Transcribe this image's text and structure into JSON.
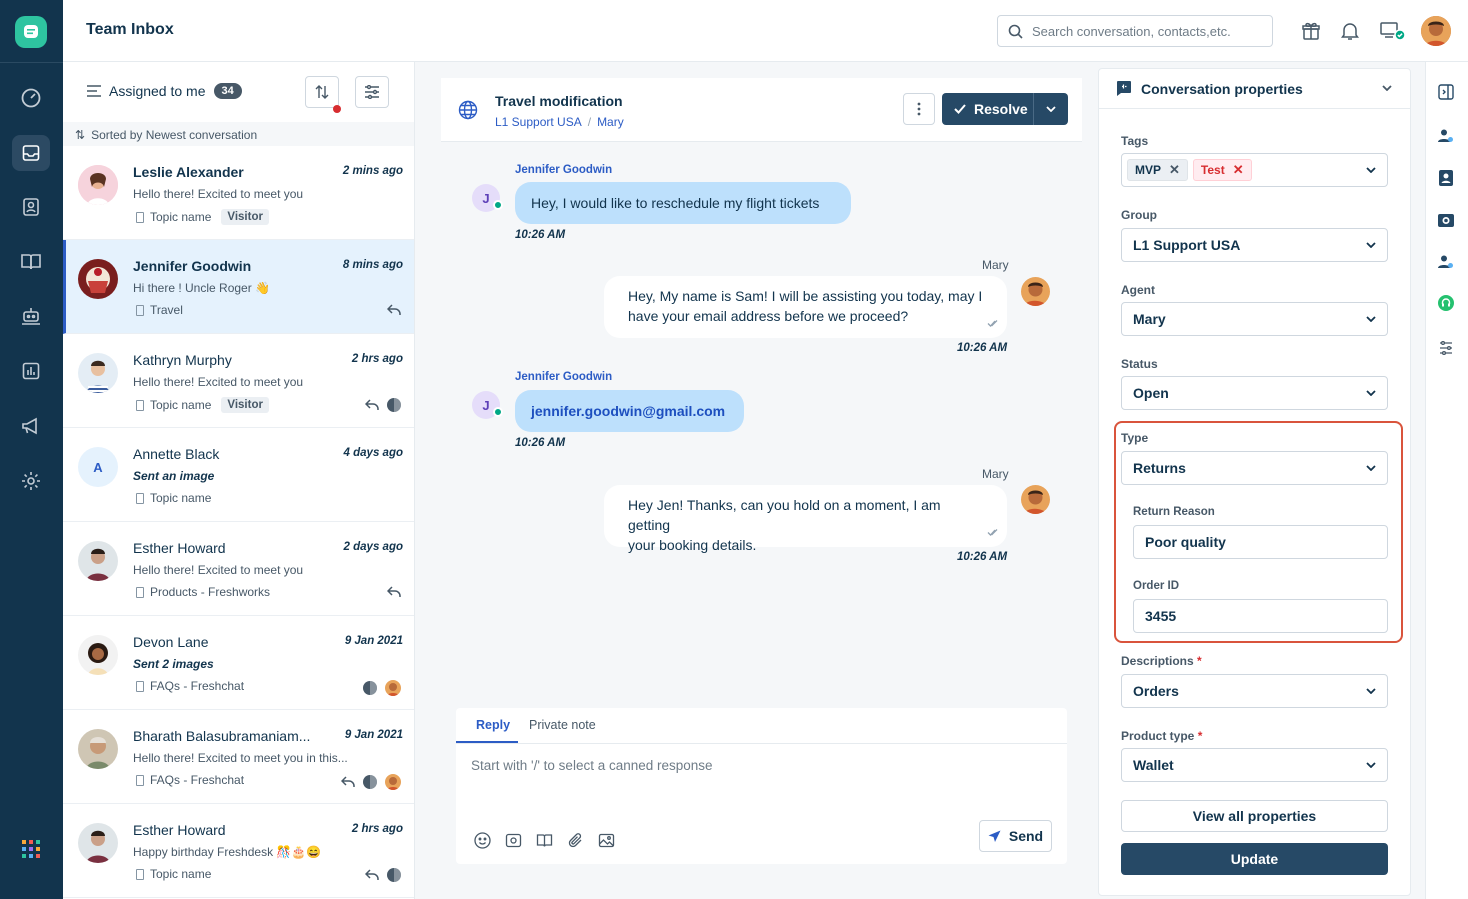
{
  "header": {
    "title": "Team Inbox",
    "search_placeholder": "Search conversation, contacts,etc."
  },
  "list": {
    "filter_label": "Assigned to me",
    "count": "34",
    "sorted_label": "Sorted by Newest conversation",
    "items": [
      {
        "name": "Leslie Alexander",
        "time": "2 mins ago",
        "preview": "Hello there! Excited to meet you",
        "topic": "Topic name",
        "tag": "Visitor"
      },
      {
        "name": "Jennifer Goodwin",
        "time": "8 mins ago",
        "preview": "Hi there ! Uncle Roger 👋",
        "topic": "Travel"
      },
      {
        "name": "Kathryn Murphy",
        "time": "2 hrs ago",
        "preview": "Hello there! Excited to meet you",
        "topic": "Topic name",
        "tag": "Visitor"
      },
      {
        "name": "Annette Black",
        "time": "4 days ago",
        "preview": "Sent an image",
        "topic": "Topic name",
        "initial": "A"
      },
      {
        "name": "Esther Howard",
        "time": "2 days ago",
        "preview": "Hello there! Excited to meet you",
        "topic": "Products - Freshworks"
      },
      {
        "name": "Devon Lane",
        "time": "9 Jan 2021",
        "preview": "Sent 2 images",
        "topic": "FAQs - Freshchat"
      },
      {
        "name": "Bharath Balasubramaniam...",
        "time": "9 Jan 2021",
        "preview": "Hello there! Excited to meet you in this...",
        "topic": "FAQs - Freshchat"
      },
      {
        "name": "Esther Howard",
        "time": "2 hrs ago",
        "preview": "Happy birthday Freshdesk 🎊🎂😄",
        "topic": "Topic name"
      }
    ]
  },
  "chat": {
    "title": "Travel modification",
    "breadcrumb": [
      "L1 Support USA",
      "/",
      "Mary"
    ],
    "resolve_label": "Resolve",
    "messages": [
      {
        "sender": "Jennifer Goodwin",
        "text": "Hey, I would like to reschedule my flight tickets",
        "time": "10:26 AM",
        "avatar": "J"
      },
      {
        "sender": "Mary",
        "line1": "Hey, My name is Sam! I will be assisting you today, may I",
        "line2": "have your email address before we proceed?",
        "time": "10:26 AM"
      },
      {
        "sender": "Jennifer Goodwin",
        "text": "jennifer.goodwin@gmail.com",
        "time": "10:26 AM",
        "avatar": "J"
      },
      {
        "sender": "Mary",
        "line1": "Hey Jen! Thanks, can you hold on a moment, I am getting",
        "line2": "your booking details.",
        "time": "10:26 AM"
      }
    ],
    "reply": {
      "tab_reply": "Reply",
      "tab_note": "Private note",
      "placeholder": "Start with '/' to select a canned response",
      "send_label": "Send"
    }
  },
  "props": {
    "title": "Conversation properties",
    "tags_label": "Tags",
    "tags": [
      "MVP",
      "Test"
    ],
    "group_label": "Group",
    "group_value": "L1 Support USA",
    "agent_label": "Agent",
    "agent_value": "Mary",
    "status_label": "Status",
    "status_value": "Open",
    "type_label": "Type",
    "type_value": "Returns",
    "return_reason_label": "Return Reason",
    "return_reason_value": "Poor quality",
    "order_id_label": "Order ID",
    "order_id_value": "3455",
    "descriptions_label": "Descriptions",
    "descriptions_value": "Orders",
    "product_type_label": "Product type",
    "product_type_value": "Wallet",
    "required_mark": "*",
    "view_all_label": "View all properties",
    "update_label": "Update"
  },
  "colors": {
    "rail": "#12344d",
    "accent": "#2c5cc5",
    "primary_button": "#264966",
    "highlight": "#d9543c",
    "bubble_in": "#bde0fc"
  }
}
